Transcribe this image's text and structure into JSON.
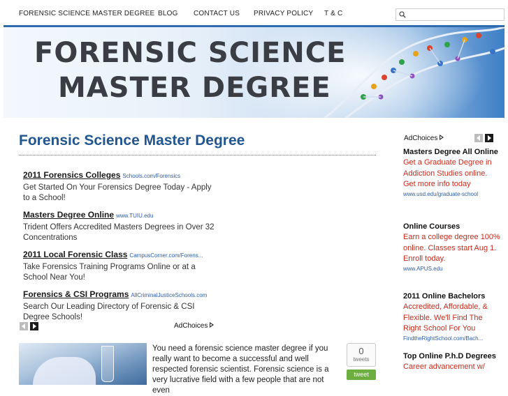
{
  "nav": {
    "items": [
      "FORENSIC SCIENCE MASTER DEGREE",
      "BLOG",
      "CONTACT US",
      "PRIVACY POLICY",
      "T & C"
    ],
    "search_placeholder": ""
  },
  "banner": {
    "line1": "FORENSIC SCIENCE",
    "line2": "MASTER DEGREE"
  },
  "main": {
    "title": "Forensic Science Master Degree",
    "ads": [
      {
        "title": "2011 Forensics Colleges",
        "url": "Schools.com/Forensics",
        "desc": "Get Started On Your Forensics Degree Today - Apply to a School!"
      },
      {
        "title": "Masters Degree Online",
        "url": "www.TUIU.edu",
        "desc": "Trident Offers Accredited Masters Degrees in Over 32 Concentrations"
      },
      {
        "title": "2011 Local Forensic Class",
        "url": "CampusCorner.com/Forens...",
        "desc": "Take Forensics Training Programs Online or at a School Near You!"
      },
      {
        "title": "Forensics & CSI Programs",
        "url": "AllCriminalJusticeSchools.com",
        "desc": "Search Our Leading Directory of Forensic & CSI Degree Schools!"
      }
    ],
    "adchoices_label": "AdChoices",
    "article_text": "You need a forensic science master degree if you really want to become a successful and well respected forensic scientist. Forensic science is a very lucrative field with a few people that are not even",
    "tweet_count": "0",
    "tweet_count_label": "tweets",
    "tweet_button": "tweet"
  },
  "sidebar": {
    "adchoices_label": "AdChoices",
    "ads": [
      {
        "title": "Masters Degree All Online",
        "desc": "Get a Graduate Degree in Addiction Studies online. Get more info today",
        "url": "www.usd.edu/graduate-school"
      },
      {
        "title": "Online Courses",
        "desc": "Earn a college degree 100% online. Classes start Aug 1. Enroll today.",
        "url": "www.APUS.edu"
      },
      {
        "title": "2011 Online Bachelors",
        "desc": "Accredited, Affordable, & Flexible. We'll Find The Right School For You",
        "url": "FindtheRightSchool.com/Bach..."
      },
      {
        "title": "Top Online P.h.D Degrees",
        "desc": "Career advancement w/",
        "url": ""
      }
    ]
  },
  "colors": {
    "accent_blue": "#2e6bb0",
    "title_blue": "#22568f",
    "ad_red": "#c62a1a",
    "tweet_green": "#6cae3f"
  }
}
